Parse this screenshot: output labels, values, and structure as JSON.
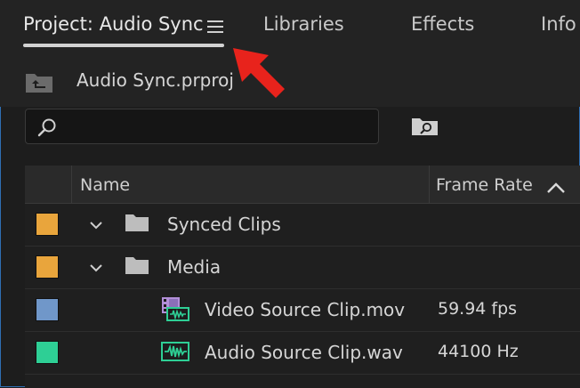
{
  "tabs": [
    {
      "label": "Project: Audio Sync",
      "active": true
    },
    {
      "label": "Libraries"
    },
    {
      "label": "Effects"
    },
    {
      "label": "Info"
    }
  ],
  "panel_menu_icon": "hamburger-menu-icon",
  "project": {
    "file_name": "Audio Sync.prproj"
  },
  "search": {
    "value": "",
    "placeholder": ""
  },
  "table": {
    "columns": [
      {
        "label": "Name"
      },
      {
        "label": "Frame Rate",
        "sort": "ascending"
      }
    ],
    "rows": [
      {
        "label": "Synced Clips",
        "type": "bin",
        "swatch": "#e9a53c",
        "value": ""
      },
      {
        "label": "Media",
        "type": "bin",
        "swatch": "#e9a53c",
        "value": ""
      },
      {
        "label": "Video Source Clip.mov",
        "type": "video-clip",
        "swatch": "#7097c9",
        "value": "59.94 fps"
      },
      {
        "label": "Audio Source Clip.wav",
        "type": "audio-clip",
        "swatch": "#2ecf95",
        "value": "44100 Hz"
      }
    ]
  },
  "colors": {
    "accent": "#2f6fb3",
    "annotation_arrow": "#e8231c"
  }
}
